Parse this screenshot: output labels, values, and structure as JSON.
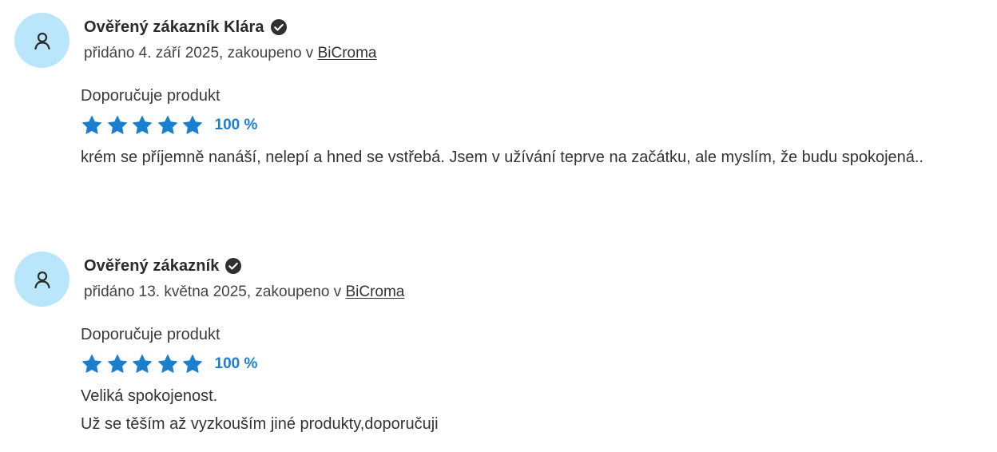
{
  "reviews": [
    {
      "author": "Ověřený zákazník Klára",
      "meta_prefix": "přidáno 4. září 2025, zakoupeno v ",
      "shop": "BiCroma",
      "recommend": "Doporučuje produkt",
      "stars": 5,
      "stars_max": 5,
      "rating_percent": "100 %",
      "text_lines": [
        "krém se příjemně nanáší, nelepí a hned se vstřebá. Jsem v užívání teprve na začátku, ale myslím, že budu spokojená.."
      ]
    },
    {
      "author": "Ověřený zákazník",
      "meta_prefix": "přidáno 13. května 2025, zakoupeno v ",
      "shop": "BiCroma",
      "recommend": "Doporučuje produkt",
      "stars": 5,
      "stars_max": 5,
      "rating_percent": "100 %",
      "text_lines": [
        "Veliká spokojenost.",
        "Už se těším až vyzkouším jiné produkty,doporučuji"
      ]
    }
  ],
  "icons": {
    "avatar": "user-icon",
    "verified": "verified-check-icon",
    "star": "star-icon"
  },
  "colors": {
    "avatar_bg": "#b9e6fb",
    "star": "#1b7fd0",
    "percent": "#1b7fd0",
    "verified": "#2f2f2f"
  }
}
